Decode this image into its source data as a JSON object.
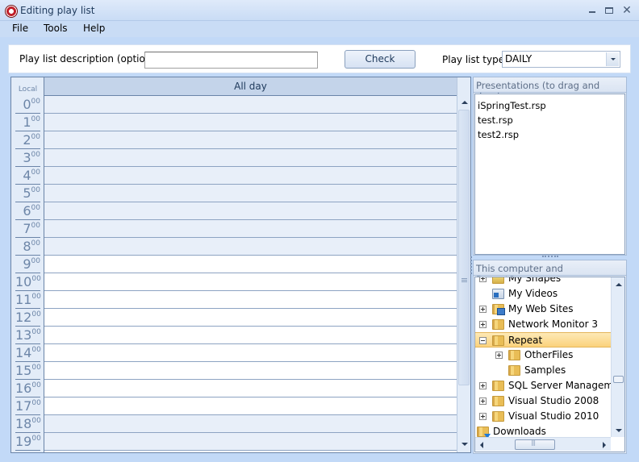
{
  "window": {
    "title": "Editing play list",
    "controls": {
      "minimize": "minimize",
      "maximize": "maximize",
      "close": "✕"
    }
  },
  "menu": [
    {
      "label": "File"
    },
    {
      "label": "Tools"
    },
    {
      "label": "Help"
    }
  ],
  "toolbar": {
    "description_label": "Play list description (optional)",
    "description_value": "",
    "check_label": "Check",
    "type_label": "Play list type",
    "type_value": "DAILY"
  },
  "schedule": {
    "time_column_label": "Local",
    "column_header": "All day",
    "minute_suffix": "00",
    "hours": [
      "0",
      "1",
      "2",
      "3",
      "4",
      "5",
      "6",
      "7",
      "8",
      "9",
      "10",
      "11",
      "12",
      "13",
      "14",
      "15",
      "16",
      "17",
      "18",
      "19"
    ],
    "working_hours": [
      "9",
      "10",
      "11",
      "12",
      "13",
      "14",
      "15",
      "16",
      "17"
    ]
  },
  "presentations": {
    "title": "Presentations (to drag and drop)",
    "items": [
      "iSpringTest.rsp",
      "test.rsp",
      "test2.rsp"
    ]
  },
  "tree": {
    "title": "This computer and RepeatServer",
    "nodes": [
      {
        "label": "My Shapes",
        "expander": "plus",
        "icon": "shapes-folder-icon",
        "level": 1
      },
      {
        "label": "My Videos",
        "expander": "none",
        "icon": "videos-folder-icon",
        "level": 1
      },
      {
        "label": "My Web Sites",
        "expander": "plus",
        "icon": "web-folder-icon",
        "level": 1
      },
      {
        "label": "Network Monitor 3",
        "expander": "plus",
        "icon": "folder-icon",
        "level": 1
      },
      {
        "label": "Repeat",
        "expander": "minus",
        "icon": "folder-icon",
        "level": 1,
        "selected": true
      },
      {
        "label": "OtherFiles",
        "expander": "plus",
        "icon": "folder-icon",
        "level": 2
      },
      {
        "label": "Samples",
        "expander": "none",
        "icon": "folder-icon",
        "level": 2
      },
      {
        "label": "SQL  Server  Managem...",
        "expander": "plus",
        "icon": "folder-icon",
        "level": 1
      },
      {
        "label": "Visual Studio 2008",
        "expander": "plus",
        "icon": "folder-icon",
        "level": 1
      },
      {
        "label": "Visual Studio 2010",
        "expander": "plus",
        "icon": "folder-icon",
        "level": 1
      },
      {
        "label": "Downloads",
        "expander": "none",
        "icon": "downloads-folder-icon",
        "level": 0
      }
    ]
  },
  "colors": {
    "selection": "#fbd27c",
    "header": "#c4d4ea",
    "off_hours": "#e8eff9",
    "hour_text": "#6d86a8"
  }
}
